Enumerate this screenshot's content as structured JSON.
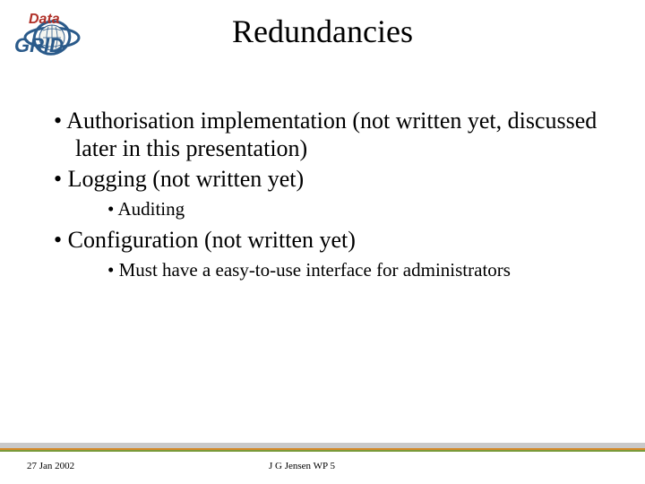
{
  "logo": {
    "text_top": "Data",
    "text_bottom": "GRID"
  },
  "title": "Redundancies",
  "bullets": {
    "b1": "Authorisation implementation (not written yet, discussed later in this presentation)",
    "b2": "Logging (not written yet)",
    "b2a": "Auditing",
    "b3": "Configuration (not written yet)",
    "b3a": "Must have a easy-to-use interface for administrators"
  },
  "footer": {
    "date": "27 Jan 2002",
    "author": "J G Jensen WP 5"
  }
}
